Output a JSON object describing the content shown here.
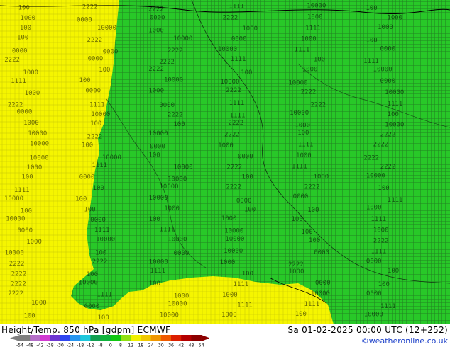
{
  "title": "Height/Temp. 850 hPa [gdpm] ECMWF",
  "datetime": "Sa 01-02-2025 00:00 UTC (12+252)",
  "credit": "©weatheronline.co.uk",
  "colorbar": {
    "ticks": [
      "-54",
      "-48",
      "-42",
      "-38",
      "-30",
      "-24",
      "-18",
      "-12",
      "-8",
      "0",
      "8",
      "12",
      "18",
      "24",
      "30",
      "36",
      "42",
      "48",
      "54"
    ],
    "colors": [
      "#7f7f7f",
      "#b46ec8",
      "#d23cd2",
      "#6e37d2",
      "#2f46f0",
      "#2796f0",
      "#1ec8dc",
      "#12a050",
      "#10b43c",
      "#12c812",
      "#90e010",
      "#f0f000",
      "#f0c800",
      "#f09600",
      "#f05a00",
      "#dc1e00",
      "#b40000",
      "#8c0000"
    ]
  },
  "map": {
    "regions": [
      {
        "name": "warm-west",
        "value_label": "1",
        "color": "#f5f500"
      },
      {
        "name": "cool-east",
        "value_label": "2",
        "color": "#28c828"
      }
    ],
    "contour_labels": [
      "100",
      "1000",
      "10000",
      "2222",
      "1111",
      "0000"
    ]
  }
}
